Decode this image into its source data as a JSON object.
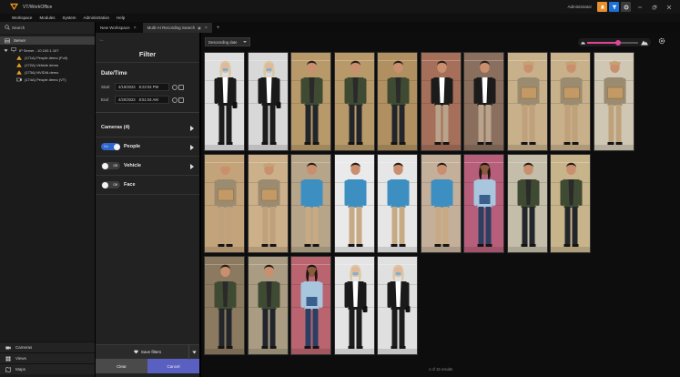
{
  "app": {
    "title": "VT/WorkOffice",
    "user": "Administrator"
  },
  "menu": [
    "Workspace",
    "Modules",
    "System",
    "Administration",
    "Help"
  ],
  "tabs": [
    {
      "label": "New Workspace",
      "active": false
    },
    {
      "label": "Multi-AI Recording Search",
      "active": true
    }
  ],
  "sidebar": {
    "search_label": "Search",
    "server_label": "Server",
    "root_label": "IP Server - 10.100.1.107",
    "cameras": [
      "(171A) People demo (Full)",
      "(172A) Vehicle demo",
      "(173A) NVIDIA demo",
      "(174A) People demo (VT)"
    ],
    "bottom": [
      "Cameras",
      "Views",
      "Maps"
    ]
  },
  "filter": {
    "back": "←",
    "title": "Filter",
    "datetime_title": "Date/Time",
    "start_label": "Start",
    "start_date": "4/19/2023",
    "start_time": "8:22:04 PM",
    "end_label": "End",
    "end_date": "4/20/2023",
    "end_time": "8:51:04 AM",
    "cameras_label": "Cameras (4)",
    "people_label": "People",
    "people_toggle": "On",
    "vehicle_label": "Vehicle",
    "vehicle_toggle": "Off",
    "face_label": "Face",
    "face_toggle": "Off",
    "save_filters": "Save filters",
    "clear": "Clear",
    "cancel": "Cancel"
  },
  "results": {
    "sort": "Descending date",
    "zoom_level": 0.6,
    "count_text": "1 of 15 results"
  },
  "thumbnails": [
    {
      "row": 0,
      "col": 0,
      "type": "woman",
      "shirt": "#ffffff",
      "pants": "#1c1c1c",
      "jacket": "#1a1a1a",
      "skin": "#e2b89a",
      "hair": "#d9c9a3",
      "bg": "#dedede"
    },
    {
      "row": 0,
      "col": 1,
      "type": "woman",
      "shirt": "#ffffff",
      "pants": "#1c1c1c",
      "jacket": "#1a1a1a",
      "skin": "#e2b89a",
      "hair": "#d9c9a3",
      "bg": "#d8d8d8"
    },
    {
      "row": 0,
      "col": 2,
      "type": "man",
      "shirt": "#2a2a2a",
      "pants": "#22262b",
      "jacket": "#3f4a33",
      "skin": "#c98f6e",
      "hair": "#2a1d15",
      "bg": "#b89a6a"
    },
    {
      "row": 0,
      "col": 3,
      "type": "man",
      "shirt": "#2a2a2a",
      "pants": "#22262b",
      "jacket": "#3f4a33",
      "skin": "#c98f6e",
      "hair": "#2a1d15",
      "bg": "#b89a6a"
    },
    {
      "row": 0,
      "col": 4,
      "type": "man",
      "shirt": "#2a2a2a",
      "pants": "#22262b",
      "jacket": "#3f4a33",
      "skin": "#c98f6e",
      "hair": "#2a1d15",
      "bg": "#b09060"
    },
    {
      "row": 0,
      "col": 5,
      "type": "man",
      "shirt": "#ffffff",
      "pants": "#b9a38a",
      "jacket": "#1b1b1b",
      "skin": "#c98f6e",
      "hair": "#2a1d15",
      "bg": "#a56f5a"
    },
    {
      "row": 0,
      "col": 6,
      "type": "man",
      "shirt": "#ffffff",
      "pants": "#b9a38a",
      "jacket": "#1b1b1b",
      "skin": "#c98f6e",
      "hair": "#2a1d15",
      "bg": "#8a6f5e"
    },
    {
      "row": 0,
      "col": 7,
      "type": "box",
      "shirt": "#9b8b70",
      "pants": "#bfa17c",
      "jacket": "#9b8b70",
      "skin": "#c98f6e",
      "hair": "#c1a87c",
      "bg": "#c7b08a"
    },
    {
      "row": 0,
      "col": 8,
      "type": "box",
      "shirt": "#9b8b70",
      "pants": "#bfa17c",
      "jacket": "#9b8b70",
      "skin": "#c98f6e",
      "hair": "#c1a87c",
      "bg": "#c7b08a"
    },
    {
      "row": 0,
      "col": 9,
      "type": "box",
      "shirt": "#9b8b70",
      "pants": "#bfa17c",
      "jacket": "#9b8b70",
      "skin": "#c98f6e",
      "hair": "#c1a87c",
      "bg": "#cfc6b3"
    },
    {
      "row": 1,
      "col": 0,
      "type": "box",
      "shirt": "#9b8b70",
      "pants": "#bfa17c",
      "jacket": "#9b8b70",
      "skin": "#c98f6e",
      "hair": "#c1a87c",
      "bg": "#c3a47a"
    },
    {
      "row": 1,
      "col": 1,
      "type": "box",
      "shirt": "#9b8b70",
      "pants": "#bfa17c",
      "jacket": "#9b8b70",
      "skin": "#c98f6e",
      "hair": "#c1a87c",
      "bg": "#cbb08a"
    },
    {
      "row": 1,
      "col": 2,
      "type": "man",
      "shirt": "#3d8fc2",
      "pants": "#c7a983",
      "jacket": "#3d8fc2",
      "skin": "#c98f6e",
      "hair": "#2a1d15",
      "bg": "#b7a58a"
    },
    {
      "row": 1,
      "col": 3,
      "type": "man",
      "shirt": "#3d8fc2",
      "pants": "#c7a983",
      "jacket": "#3d8fc2",
      "skin": "#c98f6e",
      "hair": "#2a1d15",
      "bg": "#eaeaea"
    },
    {
      "row": 1,
      "col": 4,
      "type": "man",
      "shirt": "#3d8fc2",
      "pants": "#c7a983",
      "jacket": "#3d8fc2",
      "skin": "#c98f6e",
      "hair": "#2a1d15",
      "bg": "#e6e6e6"
    },
    {
      "row": 1,
      "col": 5,
      "type": "man",
      "shirt": "#3d8fc2",
      "pants": "#c7a983",
      "jacket": "#3d8fc2",
      "skin": "#c98f6e",
      "hair": "#2a1d15",
      "bg": "#c4b09a"
    },
    {
      "row": 1,
      "col": 6,
      "type": "woman2",
      "shirt": "#a8c6dd",
      "pants": "#2b3f63",
      "jacket": "#a8c6dd",
      "skin": "#8a5a3e",
      "hair": "#1e1410",
      "bg": "#b75f7a"
    },
    {
      "row": 1,
      "col": 7,
      "type": "man",
      "shirt": "#2a2a2a",
      "pants": "#22262b",
      "jacket": "#3f4a33",
      "skin": "#c98f6e",
      "hair": "#2a1d15",
      "bg": "#c3bda9"
    },
    {
      "row": 1,
      "col": 8,
      "type": "man",
      "shirt": "#2a2a2a",
      "pants": "#22262b",
      "jacket": "#3f4a33",
      "skin": "#c98f6e",
      "hair": "#2a1d15",
      "bg": "#c7b48b"
    },
    {
      "row": 2,
      "col": 0,
      "type": "man",
      "shirt": "#2a2a2a",
      "pants": "#22262b",
      "jacket": "#3f4a33",
      "skin": "#c98f6e",
      "hair": "#2a1d15",
      "bg": "#8c7a60"
    },
    {
      "row": 2,
      "col": 1,
      "type": "man",
      "shirt": "#2a2a2a",
      "pants": "#22262b",
      "jacket": "#3f4a33",
      "skin": "#c98f6e",
      "hair": "#2a1d15",
      "bg": "#a99c82"
    },
    {
      "row": 2,
      "col": 2,
      "type": "woman2",
      "shirt": "#a8c6dd",
      "pants": "#2b3f63",
      "jacket": "#a8c6dd",
      "skin": "#8a5a3e",
      "hair": "#1e1410",
      "bg": "#b9646f"
    },
    {
      "row": 2,
      "col": 3,
      "type": "woman",
      "shirt": "#ffffff",
      "pants": "#1c1c1c",
      "jacket": "#1a1a1a",
      "skin": "#e2b89a",
      "hair": "#d9c9a3",
      "bg": "#e4e4e4"
    },
    {
      "row": 2,
      "col": 4,
      "type": "woman",
      "shirt": "#ffffff",
      "pants": "#1c1c1c",
      "jacket": "#1a1a1a",
      "skin": "#e2b89a",
      "hair": "#d9c9a3",
      "bg": "#e0e0e0"
    }
  ]
}
